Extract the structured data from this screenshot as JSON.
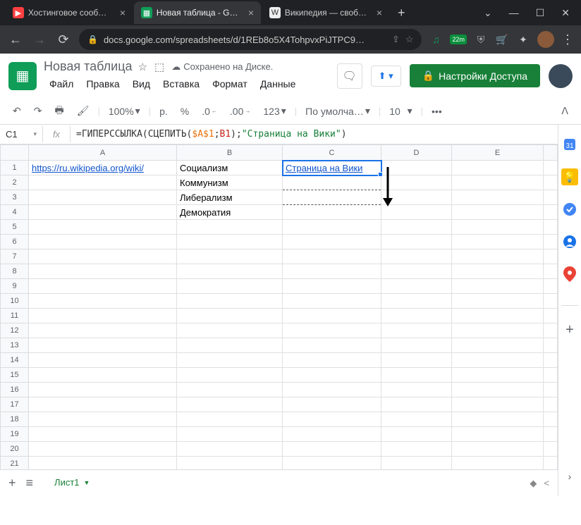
{
  "browser": {
    "tabs": [
      {
        "title": "Хостинговое сообщес",
        "active": false
      },
      {
        "title": "Новая таблица - Goog",
        "active": true
      },
      {
        "title": "Википедия — свободн",
        "active": false
      }
    ],
    "url": "docs.google.com/spreadsheets/d/1REb8o5X4TohpvxPiJTPC9…",
    "ext_badge": "22m"
  },
  "header": {
    "title": "Новая таблица",
    "saved": "Сохранено на Диске.",
    "menus": [
      "Файл",
      "Правка",
      "Вид",
      "Вставка",
      "Формат",
      "Данные"
    ],
    "share": "Настройки Доступа"
  },
  "toolbar": {
    "zoom": "100%",
    "currency": "р.",
    "percent": "%",
    "dec_less": ".0",
    "dec_more": ".00",
    "num123": "123",
    "font": "По умолча…",
    "fontsize": "10",
    "more": "•••"
  },
  "formula_bar": {
    "cell": "C1",
    "fx": "fx",
    "formula_parts": {
      "p1": "=ГИПЕРССЫЛКА(СЦЕПИТЬ(",
      "ref1": "$A$1",
      "sep1": ";",
      "ref2": "B1",
      "p2": ");",
      "str": "\"Страница на Вики\"",
      "p3": ")"
    }
  },
  "grid": {
    "cols": [
      "A",
      "B",
      "C",
      "D",
      "E"
    ],
    "rows": 22,
    "cells": {
      "A1": "https://ru.wikipedia.org/wiki/",
      "B1": "Социализм",
      "B2": "Коммунизм",
      "B3": "Либерализм",
      "B4": "Демократия",
      "C1": "Страница на Вики"
    }
  },
  "sheet_tabs": {
    "name": "Лист1"
  },
  "sidepanel": {
    "items": [
      "calendar",
      "keep",
      "tasks",
      "contacts",
      "maps"
    ]
  }
}
